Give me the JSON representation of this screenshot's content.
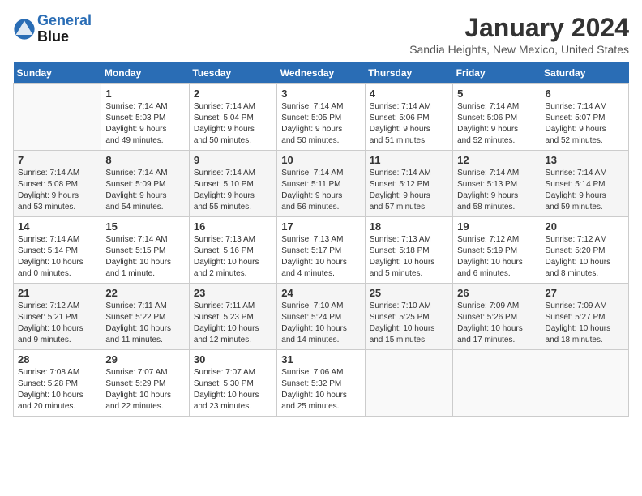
{
  "logo": {
    "line1": "General",
    "line2": "Blue"
  },
  "title": "January 2024",
  "subtitle": "Sandia Heights, New Mexico, United States",
  "weekdays": [
    "Sunday",
    "Monday",
    "Tuesday",
    "Wednesday",
    "Thursday",
    "Friday",
    "Saturday"
  ],
  "weeks": [
    [
      {
        "num": "",
        "info": ""
      },
      {
        "num": "1",
        "info": "Sunrise: 7:14 AM\nSunset: 5:03 PM\nDaylight: 9 hours\nand 49 minutes."
      },
      {
        "num": "2",
        "info": "Sunrise: 7:14 AM\nSunset: 5:04 PM\nDaylight: 9 hours\nand 50 minutes."
      },
      {
        "num": "3",
        "info": "Sunrise: 7:14 AM\nSunset: 5:05 PM\nDaylight: 9 hours\nand 50 minutes."
      },
      {
        "num": "4",
        "info": "Sunrise: 7:14 AM\nSunset: 5:06 PM\nDaylight: 9 hours\nand 51 minutes."
      },
      {
        "num": "5",
        "info": "Sunrise: 7:14 AM\nSunset: 5:06 PM\nDaylight: 9 hours\nand 52 minutes."
      },
      {
        "num": "6",
        "info": "Sunrise: 7:14 AM\nSunset: 5:07 PM\nDaylight: 9 hours\nand 52 minutes."
      }
    ],
    [
      {
        "num": "7",
        "info": "Sunrise: 7:14 AM\nSunset: 5:08 PM\nDaylight: 9 hours\nand 53 minutes."
      },
      {
        "num": "8",
        "info": "Sunrise: 7:14 AM\nSunset: 5:09 PM\nDaylight: 9 hours\nand 54 minutes."
      },
      {
        "num": "9",
        "info": "Sunrise: 7:14 AM\nSunset: 5:10 PM\nDaylight: 9 hours\nand 55 minutes."
      },
      {
        "num": "10",
        "info": "Sunrise: 7:14 AM\nSunset: 5:11 PM\nDaylight: 9 hours\nand 56 minutes."
      },
      {
        "num": "11",
        "info": "Sunrise: 7:14 AM\nSunset: 5:12 PM\nDaylight: 9 hours\nand 57 minutes."
      },
      {
        "num": "12",
        "info": "Sunrise: 7:14 AM\nSunset: 5:13 PM\nDaylight: 9 hours\nand 58 minutes."
      },
      {
        "num": "13",
        "info": "Sunrise: 7:14 AM\nSunset: 5:14 PM\nDaylight: 9 hours\nand 59 minutes."
      }
    ],
    [
      {
        "num": "14",
        "info": "Sunrise: 7:14 AM\nSunset: 5:14 PM\nDaylight: 10 hours\nand 0 minutes."
      },
      {
        "num": "15",
        "info": "Sunrise: 7:14 AM\nSunset: 5:15 PM\nDaylight: 10 hours\nand 1 minute."
      },
      {
        "num": "16",
        "info": "Sunrise: 7:13 AM\nSunset: 5:16 PM\nDaylight: 10 hours\nand 2 minutes."
      },
      {
        "num": "17",
        "info": "Sunrise: 7:13 AM\nSunset: 5:17 PM\nDaylight: 10 hours\nand 4 minutes."
      },
      {
        "num": "18",
        "info": "Sunrise: 7:13 AM\nSunset: 5:18 PM\nDaylight: 10 hours\nand 5 minutes."
      },
      {
        "num": "19",
        "info": "Sunrise: 7:12 AM\nSunset: 5:19 PM\nDaylight: 10 hours\nand 6 minutes."
      },
      {
        "num": "20",
        "info": "Sunrise: 7:12 AM\nSunset: 5:20 PM\nDaylight: 10 hours\nand 8 minutes."
      }
    ],
    [
      {
        "num": "21",
        "info": "Sunrise: 7:12 AM\nSunset: 5:21 PM\nDaylight: 10 hours\nand 9 minutes."
      },
      {
        "num": "22",
        "info": "Sunrise: 7:11 AM\nSunset: 5:22 PM\nDaylight: 10 hours\nand 11 minutes."
      },
      {
        "num": "23",
        "info": "Sunrise: 7:11 AM\nSunset: 5:23 PM\nDaylight: 10 hours\nand 12 minutes."
      },
      {
        "num": "24",
        "info": "Sunrise: 7:10 AM\nSunset: 5:24 PM\nDaylight: 10 hours\nand 14 minutes."
      },
      {
        "num": "25",
        "info": "Sunrise: 7:10 AM\nSunset: 5:25 PM\nDaylight: 10 hours\nand 15 minutes."
      },
      {
        "num": "26",
        "info": "Sunrise: 7:09 AM\nSunset: 5:26 PM\nDaylight: 10 hours\nand 17 minutes."
      },
      {
        "num": "27",
        "info": "Sunrise: 7:09 AM\nSunset: 5:27 PM\nDaylight: 10 hours\nand 18 minutes."
      }
    ],
    [
      {
        "num": "28",
        "info": "Sunrise: 7:08 AM\nSunset: 5:28 PM\nDaylight: 10 hours\nand 20 minutes."
      },
      {
        "num": "29",
        "info": "Sunrise: 7:07 AM\nSunset: 5:29 PM\nDaylight: 10 hours\nand 22 minutes."
      },
      {
        "num": "30",
        "info": "Sunrise: 7:07 AM\nSunset: 5:30 PM\nDaylight: 10 hours\nand 23 minutes."
      },
      {
        "num": "31",
        "info": "Sunrise: 7:06 AM\nSunset: 5:32 PM\nDaylight: 10 hours\nand 25 minutes."
      },
      {
        "num": "",
        "info": ""
      },
      {
        "num": "",
        "info": ""
      },
      {
        "num": "",
        "info": ""
      }
    ]
  ]
}
